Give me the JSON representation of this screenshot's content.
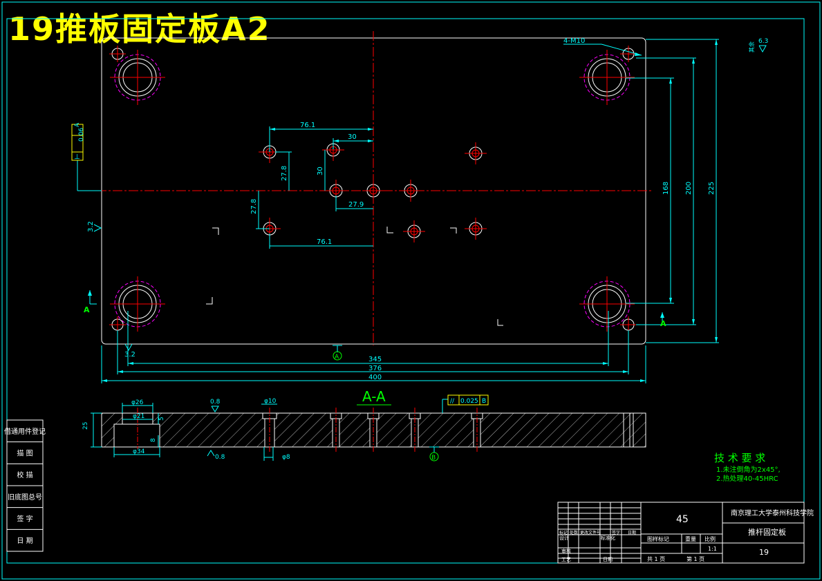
{
  "drawing_title": "19推板固定板A2",
  "dimensions": {
    "d76_1_top": "76.1",
    "d30_h": "30",
    "d30_v": "30",
    "d27_8_top": "27.8",
    "d27_8_left": "27.8",
    "d27_9": "27.9",
    "d76_1_bottom": "76.1",
    "d345": "345",
    "d376": "376",
    "d400": "400",
    "d168": "168",
    "d200": "200",
    "d225": "225",
    "d3_2_left": "3.2",
    "d3_2_bottom": "3.2",
    "hole_note": "4-M10",
    "roughness": "6.3",
    "roughness_prefix": "其余"
  },
  "tolerances": {
    "perp_symbol": "⊥",
    "perp_value": "0.06",
    "perp_ref": "A",
    "parallel_symbol": "//",
    "parallel_value": "0.025",
    "parallel_ref": "B",
    "datum_a": "A",
    "datum_b": "B"
  },
  "section": {
    "label": "A-A",
    "marker_left": "A",
    "marker_right": "A",
    "d26": "φ26",
    "d21": "φ21",
    "d34": "φ34",
    "d25": "25",
    "d5": "5",
    "d8_left": "8",
    "d10": "φ10",
    "d8": "φ8",
    "r08_top": "0.8",
    "r08_bottom": "0.8"
  },
  "tech_req": {
    "title": "技 术 要 求",
    "line1": "1.未注倒角为2x45°,",
    "line2": "2.热处理40-45HRC"
  },
  "side_table": [
    "借通用件登记",
    "描 图",
    "校 描",
    "旧底图总号",
    "签 字",
    "日 期"
  ],
  "title_block": {
    "material": "45",
    "school": "南京理工大学泰州科技学院",
    "part_name": "推杆固定板",
    "drawing_no": "19",
    "scale": "1:1",
    "col_labels": [
      "图样标记",
      "重量",
      "比例"
    ],
    "row_labels": [
      "标记",
      "处数",
      "更改文件号",
      "签字",
      "日期"
    ],
    "role_design": "设计",
    "role_std": "标准化",
    "role_check": "审核",
    "role_process": "工艺",
    "role_date": "日期",
    "sheet_total_label": "共 1 页",
    "sheet_label": "第 1 页"
  },
  "colors": {
    "frame": "#00ffff",
    "dimension": "#00ffff",
    "centerline": "#ff0000",
    "outline": "#ffffff",
    "hidden": "#ff00ff",
    "text_annotation": "#00ff00",
    "title": "#ffff00"
  }
}
